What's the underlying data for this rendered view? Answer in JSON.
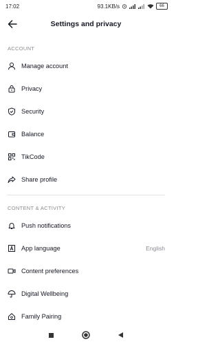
{
  "status_bar": {
    "time": "17:02",
    "network_speed": "93.1KB/s",
    "battery_level": "66"
  },
  "header": {
    "title": "Settings and privacy"
  },
  "sections": [
    {
      "label": "ACCOUNT",
      "items": [
        {
          "label": "Manage account",
          "icon": "person-icon"
        },
        {
          "label": "Privacy",
          "icon": "lock-icon"
        },
        {
          "label": "Security",
          "icon": "shield-icon"
        },
        {
          "label": "Balance",
          "icon": "wallet-icon"
        },
        {
          "label": "TikCode",
          "icon": "qr-code-icon"
        },
        {
          "label": "Share profile",
          "icon": "share-icon"
        }
      ]
    },
    {
      "label": "CONTENT & ACTIVITY",
      "items": [
        {
          "label": "Push notifications",
          "icon": "bell-icon"
        },
        {
          "label": "App language",
          "icon": "language-icon",
          "value": "English"
        },
        {
          "label": "Content preferences",
          "icon": "video-icon"
        },
        {
          "label": "Digital Wellbeing",
          "icon": "umbrella-icon"
        },
        {
          "label": "Family Pairing",
          "icon": "home-heart-icon"
        }
      ]
    }
  ],
  "colors": {
    "text": "#161823",
    "secondary": "#8a8b91",
    "divider": "#e3e3e4"
  }
}
